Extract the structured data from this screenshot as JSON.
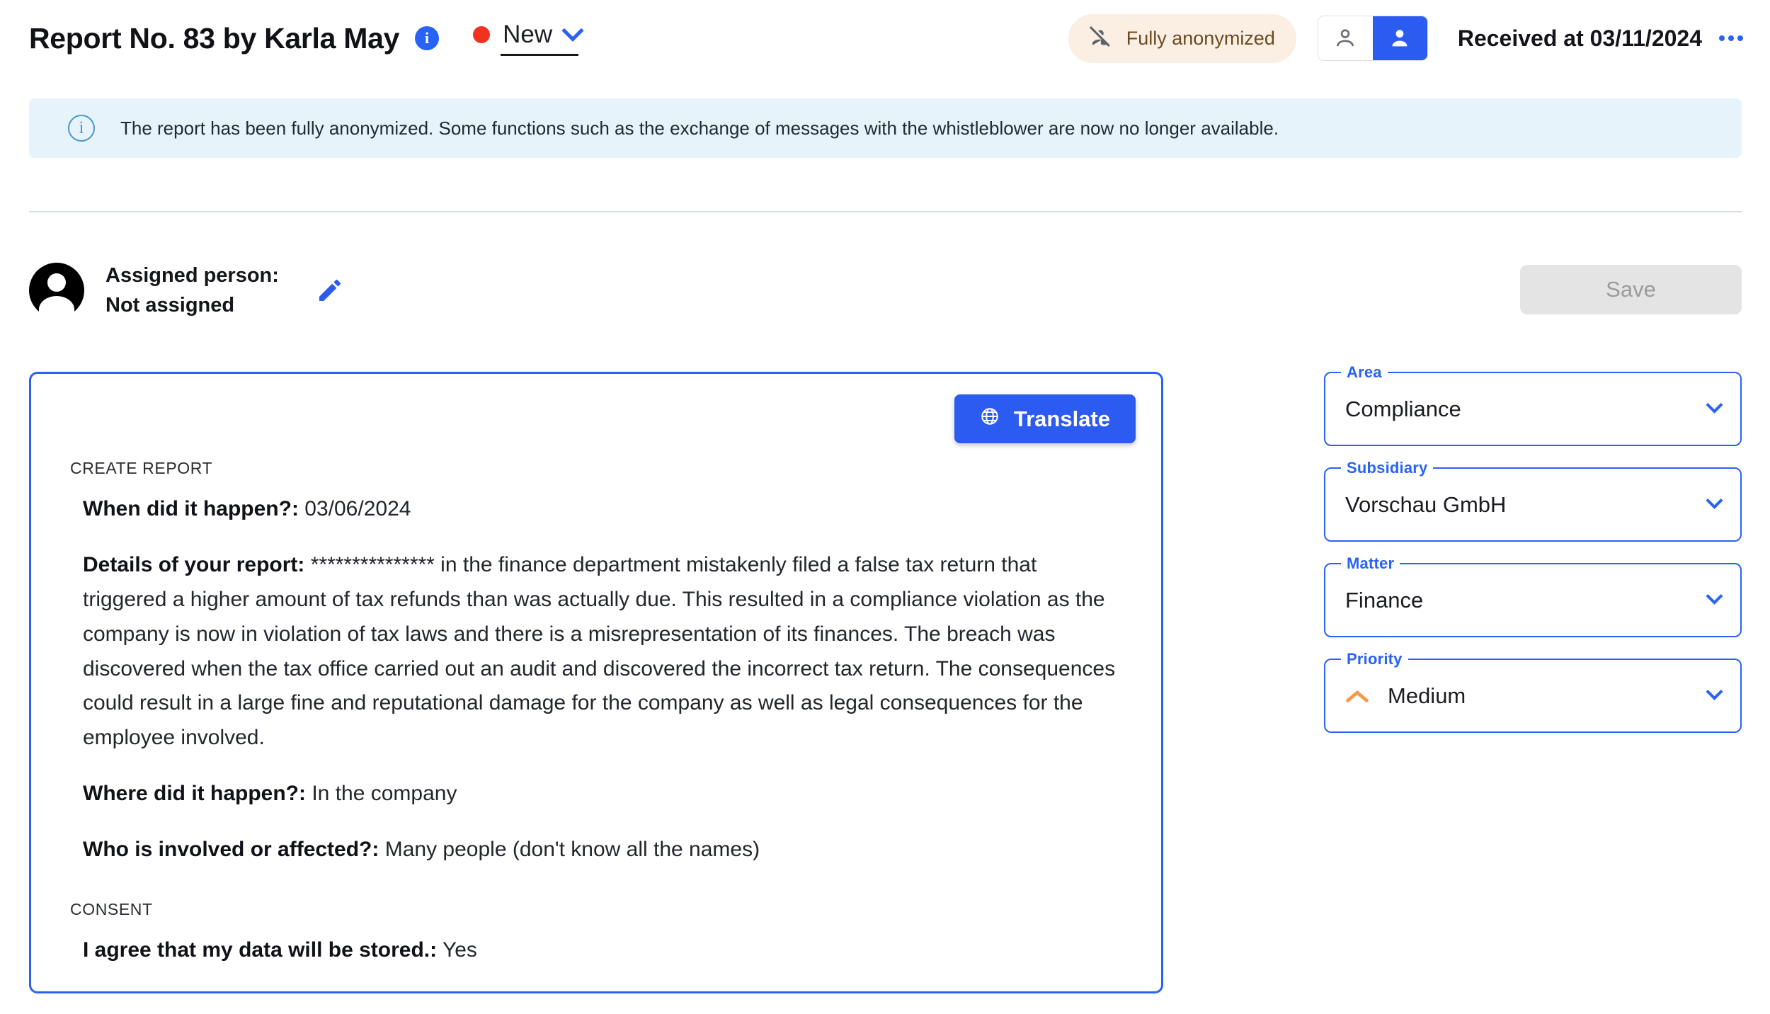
{
  "header": {
    "title": "Report No. 83 by Karla May",
    "info_icon_glyph": "i",
    "status": {
      "label": "New",
      "dot_color": "#F0321E"
    },
    "anonymized_badge": {
      "label": "Fully anonymized",
      "icon": "person-off-icon",
      "background": "#FBEEE2",
      "text_color": "#6B4A20"
    },
    "view_toggle": {
      "inactive_icon": "person-outline-icon",
      "active_icon": "person-filled-icon",
      "active_color": "#2C5BF2"
    },
    "received_text": "Received at 03/11/2024",
    "more_menu_icon": "more-horizontal-icon"
  },
  "info_banner": {
    "icon": "info-circle-icon",
    "text": "The report has been fully anonymized. Some functions such as the exchange of messages with the whistleblower are now no longer available.",
    "background": "#E7F3FB"
  },
  "assignment": {
    "label": "Assigned person:",
    "value": "Not assigned",
    "edit_icon": "pencil-icon",
    "avatar_icon": "person-avatar-icon"
  },
  "save_button": {
    "label": "Save",
    "disabled": true
  },
  "report": {
    "translate_button": {
      "label": "Translate",
      "icon": "globe-icon"
    },
    "sections": [
      {
        "heading": "CREATE REPORT",
        "items": [
          {
            "question": "When did it happen?:",
            "answer": "03/06/2024"
          },
          {
            "question": "Details of your report:",
            "answer": "*************** in the finance department mistakenly filed a false tax return that triggered a higher amount of tax refunds than was actually due. This resulted in a compliance violation as the company is now in violation of tax laws and there is a misrepresentation of its finances. The breach was discovered when the tax office carried out an audit and discovered the incorrect tax return. The consequences could result in a large fine and reputational damage for the company as well as legal consequences for the employee involved."
          },
          {
            "question": "Where did it happen?:",
            "answer": "In the company"
          },
          {
            "question": "Who is involved or affected?:",
            "answer": "Many people (don't know all the names)"
          }
        ]
      },
      {
        "heading": "CONSENT",
        "items": [
          {
            "question": "I agree that my data will be stored.:",
            "answer": "Yes"
          }
        ]
      }
    ]
  },
  "side_fields": [
    {
      "legend": "Area",
      "value": "Compliance",
      "icon": null
    },
    {
      "legend": "Subsidiary",
      "value": "Vorschau GmbH",
      "icon": null
    },
    {
      "legend": "Matter",
      "value": "Finance",
      "icon": null
    },
    {
      "legend": "Priority",
      "value": "Medium",
      "icon": "priority-medium-chevron-up-icon"
    }
  ],
  "colors": {
    "accent": "#2962F6",
    "accent_button": "#2C5BF2",
    "status_new": "#F0321E",
    "priority_medium": "#F2994A",
    "banner_bg": "#E7F3FB",
    "anon_bg": "#FBEEE2"
  }
}
